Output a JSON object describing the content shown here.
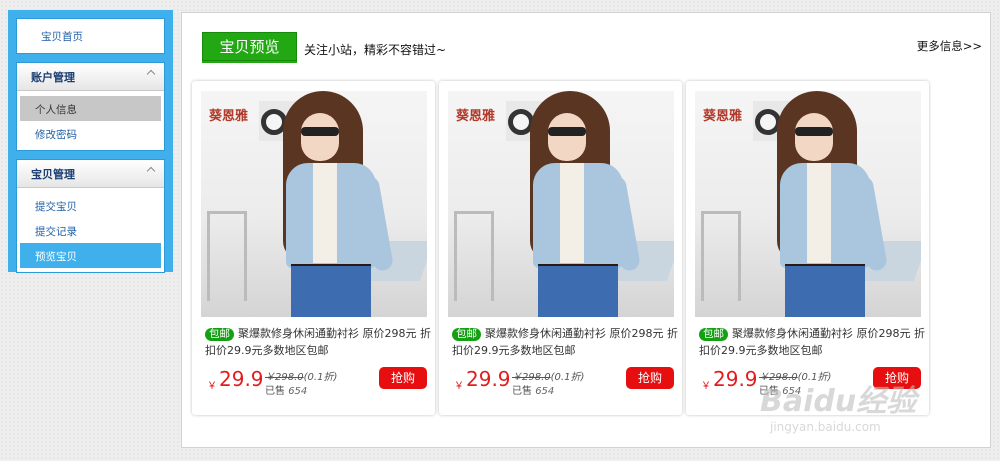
{
  "sidebar": {
    "home": "宝贝首页",
    "groups": [
      {
        "title": "账户管理",
        "items": [
          {
            "label": "个人信息",
            "state": "selected"
          },
          {
            "label": "修改密码",
            "state": "normal"
          }
        ]
      },
      {
        "title": "宝贝管理",
        "items": [
          {
            "label": "提交宝贝",
            "state": "normal"
          },
          {
            "label": "提交记录",
            "state": "normal"
          },
          {
            "label": "预览宝贝",
            "state": "active"
          }
        ]
      }
    ],
    "colors": {
      "frame": "#3fb0ec",
      "selected": "#c7c7c7",
      "active": "#3fb0ec"
    }
  },
  "main": {
    "tab": "宝贝预览",
    "subtitle": "关注小站，精彩不容错过~",
    "more": "更多信息>>",
    "products": [
      {
        "brand": "葵恩雅",
        "badge": "包邮",
        "title": "聚爆款修身休闲通勤衬衫 原价298元 折扣价29.9元多数地区包邮",
        "currency": "￥",
        "price": "29.9",
        "original": "￥298.0",
        "discount": "(0.1折)",
        "sold_label": "已售",
        "sold": "654",
        "buy": "抢购"
      },
      {
        "brand": "葵恩雅",
        "badge": "包邮",
        "title": "聚爆款修身休闲通勤衬衫 原价298元 折扣价29.9元多数地区包邮",
        "currency": "￥",
        "price": "29.9",
        "original": "￥298.0",
        "discount": "(0.1折)",
        "sold_label": "已售",
        "sold": "654",
        "buy": "抢购"
      },
      {
        "brand": "葵恩雅",
        "badge": "包邮",
        "title": "聚爆款修身休闲通勤衬衫 原价298元 折扣价29.9元多数地区包邮",
        "currency": "￥",
        "price": "29.9",
        "original": "￥298.0",
        "discount": "(0.1折)",
        "sold_label": "已售",
        "sold": "654",
        "buy": "抢购"
      }
    ],
    "colors": {
      "tab": "#22a813",
      "price": "#e21d1d",
      "buy_button": "#e60e0e",
      "badge": "#13a013"
    }
  },
  "watermark": {
    "text": "Baidu经验",
    "url": "jingyan.baidu.com"
  }
}
